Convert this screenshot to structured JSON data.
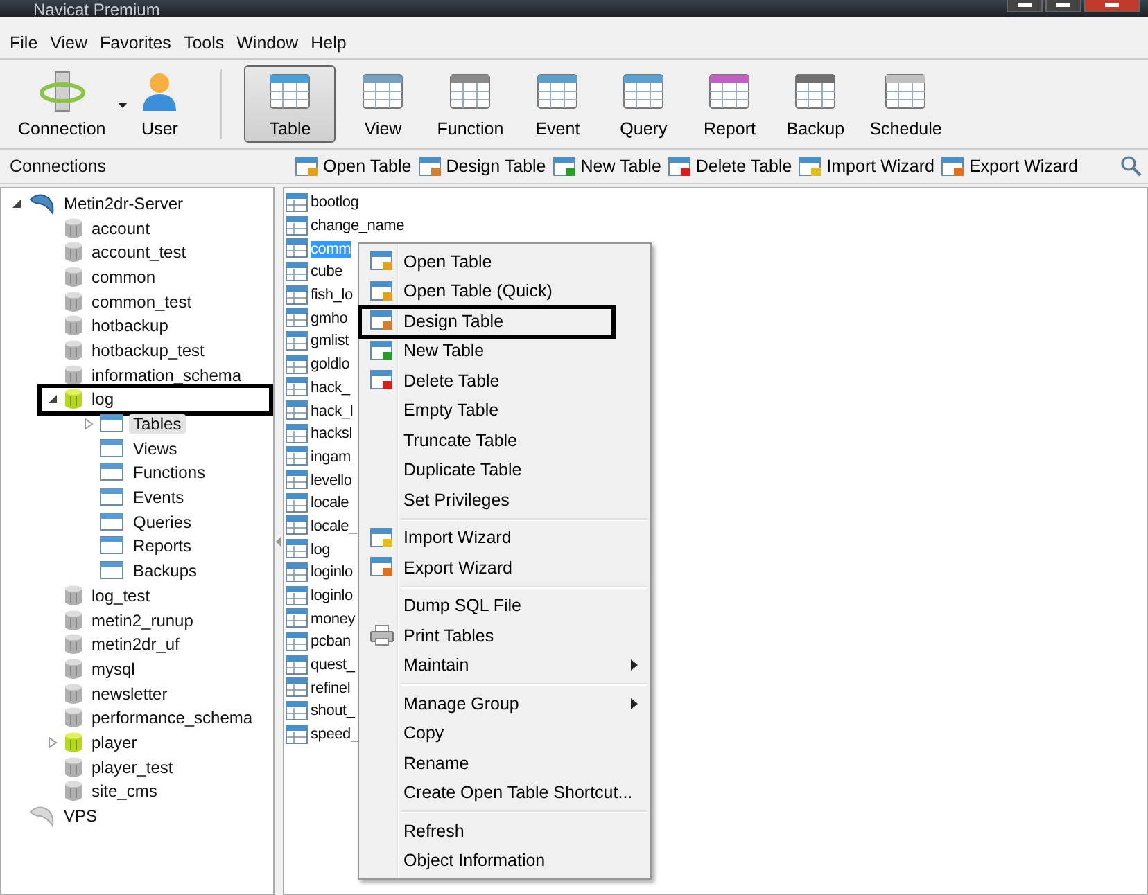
{
  "window": {
    "title": "Navicat Premium"
  },
  "menu_bar": [
    "File",
    "View",
    "Favorites",
    "Tools",
    "Window",
    "Help"
  ],
  "toolbar": [
    {
      "label": "Connection",
      "selected": false,
      "dropdown": true
    },
    {
      "label": "User",
      "selected": false
    },
    {
      "label": "Table",
      "selected": true
    },
    {
      "label": "View",
      "selected": false
    },
    {
      "label": "Function",
      "selected": false
    },
    {
      "label": "Event",
      "selected": false
    },
    {
      "label": "Query",
      "selected": false
    },
    {
      "label": "Report",
      "selected": false
    },
    {
      "label": "Backup",
      "selected": false
    },
    {
      "label": "Schedule",
      "selected": false
    }
  ],
  "connections_header": "Connections",
  "object_toolbar": [
    "Open Table",
    "Design Table",
    "New Table",
    "Delete Table",
    "Import Wizard",
    "Export Wizard"
  ],
  "tree": [
    {
      "label": "Metin2dr-Server",
      "kind": "connection",
      "open": true,
      "expanded": true,
      "children": [
        {
          "label": "account",
          "kind": "database",
          "open": false
        },
        {
          "label": "account_test",
          "kind": "database",
          "open": false
        },
        {
          "label": "common",
          "kind": "database",
          "open": false
        },
        {
          "label": "common_test",
          "kind": "database",
          "open": false
        },
        {
          "label": "hotbackup",
          "kind": "database",
          "open": false
        },
        {
          "label": "hotbackup_test",
          "kind": "database",
          "open": false
        },
        {
          "label": "information_schema",
          "kind": "database",
          "open": false
        },
        {
          "label": "log",
          "kind": "database",
          "open": true,
          "expanded": true,
          "highlighted": true,
          "children": [
            {
              "label": "Tables",
              "kind": "folder",
              "selected": true,
              "expanded": false
            },
            {
              "label": "Views",
              "kind": "folder",
              "selected": false
            },
            {
              "label": "Functions",
              "kind": "folder",
              "selected": false
            },
            {
              "label": "Events",
              "kind": "folder",
              "selected": false
            },
            {
              "label": "Queries",
              "kind": "folder",
              "selected": false
            },
            {
              "label": "Reports",
              "kind": "folder",
              "selected": false
            },
            {
              "label": "Backups",
              "kind": "folder",
              "selected": false
            }
          ]
        },
        {
          "label": "log_test",
          "kind": "database",
          "open": false
        },
        {
          "label": "metin2_runup",
          "kind": "database",
          "open": false
        },
        {
          "label": "metin2dr_uf",
          "kind": "database",
          "open": false
        },
        {
          "label": "mysql",
          "kind": "database",
          "open": false
        },
        {
          "label": "newsletter",
          "kind": "database",
          "open": false
        },
        {
          "label": "performance_schema",
          "kind": "database",
          "open": false
        },
        {
          "label": "player",
          "kind": "database",
          "open": true,
          "expanded": false
        },
        {
          "label": "player_test",
          "kind": "database",
          "open": false
        },
        {
          "label": "site_cms",
          "kind": "database",
          "open": false
        }
      ]
    },
    {
      "label": "VPS",
      "kind": "connection",
      "open": false
    }
  ],
  "tables": [
    {
      "name": "bootlog",
      "selected": false
    },
    {
      "name": "change_name",
      "selected": false
    },
    {
      "name": "comm",
      "selected": true
    },
    {
      "name": "cube",
      "selected": false
    },
    {
      "name": "fish_lo",
      "selected": false
    },
    {
      "name": "gmho",
      "selected": false
    },
    {
      "name": "gmlist",
      "selected": false
    },
    {
      "name": "goldlo",
      "selected": false
    },
    {
      "name": "hack_",
      "selected": false
    },
    {
      "name": "hack_l",
      "selected": false
    },
    {
      "name": "hacksl",
      "selected": false
    },
    {
      "name": "ingam",
      "selected": false
    },
    {
      "name": "levello",
      "selected": false
    },
    {
      "name": "locale",
      "selected": false
    },
    {
      "name": "locale_",
      "selected": false
    },
    {
      "name": "log",
      "selected": false
    },
    {
      "name": "loginlo",
      "selected": false
    },
    {
      "name": "loginlo",
      "selected": false
    },
    {
      "name": "money",
      "selected": false
    },
    {
      "name": "pcban",
      "selected": false
    },
    {
      "name": "quest_",
      "selected": false
    },
    {
      "name": "refinel",
      "selected": false
    },
    {
      "name": "shout_",
      "selected": false
    },
    {
      "name": "speed_",
      "selected": false
    }
  ],
  "context_menu": [
    [
      {
        "label": "Open Table",
        "kind": "open"
      },
      {
        "label": "Open Table (Quick)",
        "kind": "open"
      },
      {
        "label": "Design Table",
        "kind": "design",
        "highlighted": true
      },
      {
        "label": "New Table",
        "kind": "new"
      },
      {
        "label": "Delete Table",
        "kind": "delete"
      },
      {
        "label": "Empty Table",
        "kind": "plain"
      },
      {
        "label": "Truncate Table",
        "kind": "plain"
      },
      {
        "label": "Duplicate Table",
        "kind": "plain"
      },
      {
        "label": "Set Privileges",
        "kind": "plain"
      }
    ],
    [
      {
        "label": "Import Wizard",
        "kind": "import"
      },
      {
        "label": "Export Wizard",
        "kind": "export"
      }
    ],
    [
      {
        "label": "Dump SQL File",
        "kind": "plain"
      },
      {
        "label": "Print Tables",
        "kind": "print"
      },
      {
        "label": "Maintain",
        "kind": "plain",
        "submenu": true
      }
    ],
    [
      {
        "label": "Manage Group",
        "kind": "plain",
        "submenu": true
      },
      {
        "label": "Copy",
        "kind": "plain"
      },
      {
        "label": "Rename",
        "kind": "plain"
      },
      {
        "label": "Create Open Table Shortcut...",
        "kind": "plain"
      }
    ],
    [
      {
        "label": "Refresh",
        "kind": "plain"
      },
      {
        "label": "Object Information",
        "kind": "plain"
      }
    ]
  ]
}
